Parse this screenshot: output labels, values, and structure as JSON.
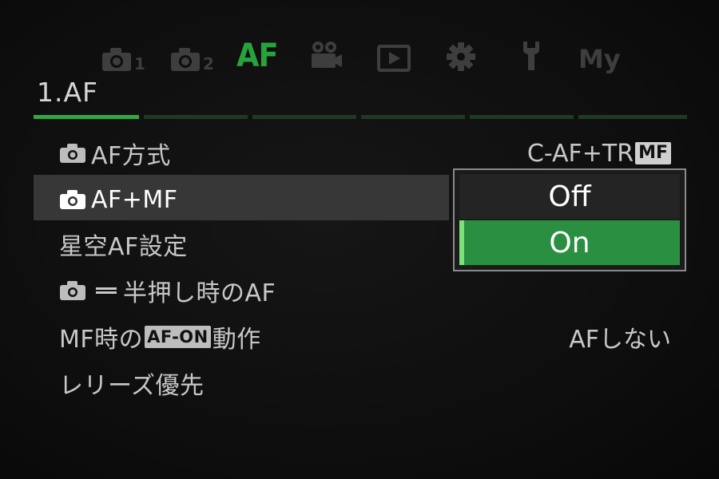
{
  "tabs": [
    {
      "name": "shooting-menu-1",
      "icon": "camera-icon",
      "sub": "1"
    },
    {
      "name": "shooting-menu-2",
      "icon": "camera-icon",
      "sub": "2"
    },
    {
      "name": "af-menu",
      "label": "AF",
      "active": true
    },
    {
      "name": "video-menu",
      "icon": "video-camera-icon"
    },
    {
      "name": "playback-menu",
      "icon": "play-icon"
    },
    {
      "name": "custom-menu",
      "icon": "gear-icon"
    },
    {
      "name": "setup-menu",
      "icon": "wrench-icon"
    },
    {
      "name": "my-menu",
      "label": "My"
    }
  ],
  "section": {
    "title": "1.AF",
    "page_count": 6,
    "active_page": 1
  },
  "items": [
    {
      "label": "AF方式",
      "camera": true,
      "value": "C-AF+TR",
      "value_badge": "MF"
    },
    {
      "label": "AF+MF",
      "camera": true,
      "selected": true
    },
    {
      "label": "星空AF設定"
    },
    {
      "label_pre": "",
      "label": "半押し時のAF",
      "camera": true,
      "halfpress": true
    },
    {
      "label_a": "MF時の",
      "badge": "AF-ON",
      "label_b": "動作",
      "value": "AFしない"
    },
    {
      "label": "レリーズ優先"
    }
  ],
  "popup": {
    "options": [
      {
        "label": "Off"
      },
      {
        "label": "On",
        "selected": true
      }
    ]
  },
  "colors": {
    "accent": "#2ea840",
    "selected_option": "#2a8f41",
    "inactive_tab": "#3e3e3e"
  }
}
